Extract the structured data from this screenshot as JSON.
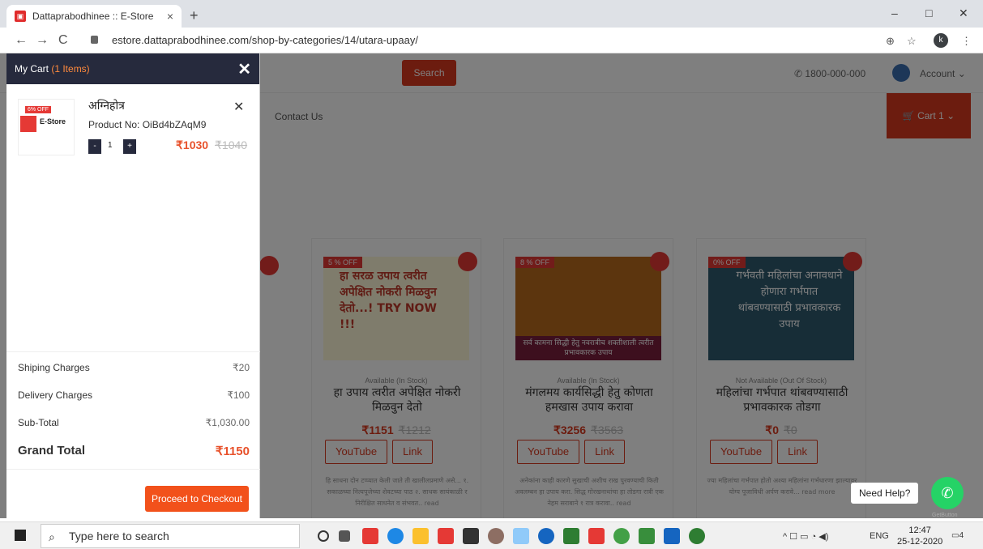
{
  "browser": {
    "tab_title": "Dattaprabodhinee :: E-Store",
    "tab_close": "×",
    "new_tab": "+",
    "url": "estore.dattaprabodhinee.com/shop-by-categories/14/utara-upaay/",
    "back": "←",
    "forward": "→",
    "reload": "C",
    "minimize": "–",
    "restore": "□",
    "close": "✕",
    "zoom_icon": "⊕",
    "star_icon": "☆",
    "profile_initial": "k",
    "menu_icon": "⋮"
  },
  "site": {
    "search_label": "Search",
    "phone": "1800-000-000",
    "account": "Account",
    "contact": "Contact Us",
    "cart_nav": "Cart 1"
  },
  "products": [
    {
      "badge": "5 % OFF",
      "img_text": "हा सरळ उपाय त्वरीत अपेक्षित नोकरी मिळवुन देतो...! TRY NOW !!!",
      "availability": "Available (In Stock)",
      "title": "हा उपाय त्वरीत अपेक्षित नोकरी मिळवुन देतो",
      "price": "₹1151",
      "old_price": "₹1212",
      "youtube": "YouTube",
      "link": "Link",
      "desc": "हि साधना दोन टप्प्यात केली जाते ती खालीलप्रमाणे असे... १. सकाळच्या नित्यपूजेच्या शेवटच्या पाठ २. साधक सायंकाळी र निरीक्षित साधनेत व संभवत.. read"
    },
    {
      "badge": "8 % OFF",
      "img_text": "सर्व कामना सिद्धी हेतु नवरात्रीच शक्तीशाली त्वरीत प्रभावकारक उपाय",
      "availability": "Available (In Stock)",
      "title": "मंगलमय कार्यसिद्धी हेतु कोणता हमखास उपाय करावा",
      "price": "₹3256",
      "old_price": "₹3563",
      "youtube": "YouTube",
      "link": "Link",
      "desc": "अनेकांना काही कारणे सुखाची अशीच राख पुरवण्याची किती अवलम्बन हा उपाय करा. सिद्ध गोरखनाथांचा हा तोडगा रात्री एक नेहम सराबाने १ रात्र करावा.. read"
    },
    {
      "badge": "0% OFF",
      "img_text": "गर्भवती महिलांचा अनावधाने होणारा गर्भपात थांबवण्यासाठी प्रभावकारक उपाय",
      "availability": "Not Available (Out Of Stock)",
      "title": "महिलांचा गर्भपात थांबवण्यासाठी प्रभावकारक तोडगा",
      "price": "₹0",
      "old_price": "₹0",
      "youtube": "YouTube",
      "link": "Link",
      "desc": "ज्या महिलांचा गर्भपात होतो अश्या महिलांना गर्भधारणा झाल्यावर योग्य पूजाविधी अर्पण करावे... read more"
    }
  ],
  "cart": {
    "title": "My Cart",
    "count": "(1 Items)",
    "close": "✕",
    "item": {
      "badge": "6% OFF",
      "logo_text": "E-Store",
      "name": "अग्निहोत्र",
      "product_no": "Product No: OiBd4bZAqM9",
      "remove": "✕",
      "minus": "-",
      "qty": "1",
      "plus": "+",
      "price": "₹1030",
      "old_price": "₹1040"
    },
    "summary": {
      "shipping_label": "Shiping Charges",
      "shipping_value": "₹20",
      "delivery_label": "Delivery Charges",
      "delivery_value": "₹100",
      "subtotal_label": "Sub-Total",
      "subtotal_value": "₹1,030.00",
      "grand_label": "Grand Total",
      "grand_value": "₹1150"
    },
    "checkout": "Proceed to Checkout"
  },
  "help": {
    "label": "Need Help?",
    "brand": "GetButton"
  },
  "taskbar": {
    "search_placeholder": "Type here to search",
    "lang": "ENG",
    "time": "12:47",
    "date": "25-12-2020",
    "notifications": "4"
  },
  "colors": {
    "accent": "#e8522c",
    "drawer_header": "#262a3d",
    "whatsapp": "#25d366"
  }
}
